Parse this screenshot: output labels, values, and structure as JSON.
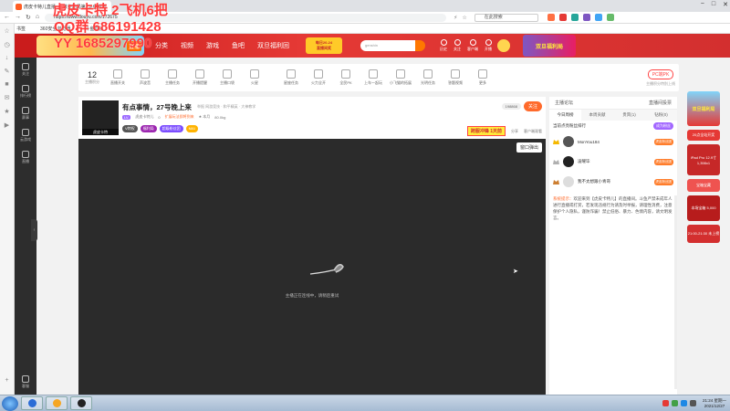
{
  "browser": {
    "tab_title": "虎皮卡特儿直播_元尊奖励局第_斗鱼直播",
    "url": "https://www.douyu.com/172675",
    "search_placeholder": "在此搜索",
    "bookmark_label": "书签",
    "bookmark_2": "360安全浏览器",
    "bookmark_3": "斗鱼直播"
  },
  "overlay": {
    "line1": "虎皮卡特    2飞机6把",
    "line2": "QQ群 686191428",
    "line3": "YY 1685297990"
  },
  "douyu_nav": {
    "items": [
      {
        "label": "关注"
      },
      {
        "label": "排行榜"
      },
      {
        "label": "赛事"
      },
      {
        "label": "云游戏"
      },
      {
        "label": "直播"
      }
    ],
    "bottom_label": "客服"
  },
  "header": {
    "live_badge": "直播",
    "menu": [
      "分类",
      "视频",
      "游戏",
      "鱼吧",
      "双旦福利回"
    ],
    "promo_line1": "每日20-24",
    "promo_line2": "直播间奖",
    "search_placeholder": "genshin",
    "icons": [
      {
        "label": "历史"
      },
      {
        "label": "关注"
      },
      {
        "label": "客户端"
      },
      {
        "label": "开播"
      }
    ],
    "banner": "双旦福利局"
  },
  "toolbar": {
    "level_num": "12",
    "level_label": "主播积分",
    "tools": [
      {
        "label": "直播开关"
      },
      {
        "label": "声波音"
      },
      {
        "label": "主播任务"
      },
      {
        "label": "开播提醒"
      },
      {
        "label": "主播口袋"
      },
      {
        "label": "火星"
      },
      {
        "label": "星座任务"
      },
      {
        "label": "火力全开"
      },
      {
        "label": "全民PK"
      },
      {
        "label": "上车一起玩"
      },
      {
        "label": "小飞猫的拓展"
      },
      {
        "label": "光明任务"
      },
      {
        "label": "答题视频"
      },
      {
        "label": "更多"
      }
    ],
    "pk_label": "PC端PK",
    "pk_sub": "主播积分特别上线"
  },
  "room": {
    "anchor_badge": "虎皮卡特",
    "title": "有点事情，27号晚上来",
    "tags": "举报   网游竞技 · 和平精英 · 大神教学",
    "level": "LV.",
    "anchor_name": "虎皮卡特儿",
    "fans": "0",
    "notice": "扩展玩法即将到来",
    "rank": "★ 本月",
    "weight": "80.0kg",
    "chips": [
      "V特权",
      "福利局",
      "超级粉丝团",
      "MAI"
    ],
    "follow_count": "198868",
    "follow_label": "关注",
    "event_tag": "跨服冲锋 1天前",
    "share": "分享",
    "report": "客户端观看"
  },
  "player": {
    "popout": "窗口弹出",
    "loading_msg": "主播正在连线中，请稍后重试"
  },
  "side_panel": {
    "title_left": "主播论坛",
    "title_right": "直播间投票",
    "tabs": [
      "今日周榜",
      "本周贡献",
      "贵宾(1)",
      "钻粉(0)"
    ],
    "sub_title": "当前点亮粉丝排行",
    "sub_btn": "成为粉丝",
    "rank": [
      {
        "name": "MonYou184",
        "badge": "虎皮粉丝团"
      },
      {
        "name": "凌曜毕",
        "badge": "虎皮粉丝团"
      },
      {
        "name": "我不太想跟小青哥",
        "badge": "虎皮粉丝团"
      }
    ],
    "chat_prefix": "系统提示：",
    "chat_text": "欢迎来到【虎皮卡特儿】的直播间。斗鱼严禁未成年人进行直播或打赏，若发现违规行为请及时举报，请理性消费，注意保护个人隐私，谨防诈骗！禁止低俗、暴力、色情内容，请文明发言。"
  },
  "right_ads": [
    {
      "text": "双旦福利局"
    },
    {
      "text": "20点全站开奖"
    },
    {
      "text": "iPad Pro 12.9寸 1,398x1"
    },
    {
      "text": "宝箱宝藏"
    },
    {
      "text": "本场宝箱 5,000"
    },
    {
      "text": "21:00-21:30 未上榜"
    }
  ],
  "taskbar": {
    "time": "21:24 星期一",
    "date": "2021/12/27"
  },
  "colors": {
    "brand": "#e53935",
    "accent": "#ff6a2b",
    "player_bg": "#2b2b2b"
  }
}
